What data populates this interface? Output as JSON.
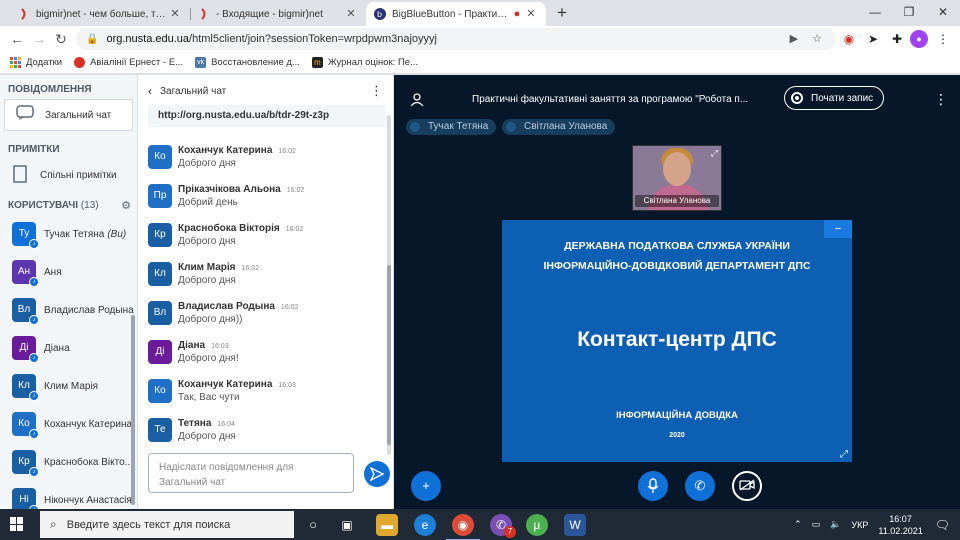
{
  "browser": {
    "tabs": [
      {
        "title": "bigmir)net - чем больше, тем лу"
      },
      {
        "title": "- Входящие - bigmir)net"
      },
      {
        "title": "BigBlueButton - Практичні з"
      }
    ],
    "url_host": "org.nusta.edu.ua",
    "url_path": "/html5client/join?sessionToken=wrpdpwm3najoyyyj",
    "bookmarks": [
      {
        "label": "Додатки",
        "color": "#4285f4"
      },
      {
        "label": "Авіалінії Ернест - Е...",
        "color": "#d93025"
      },
      {
        "label": "Восстановление д...",
        "color": "#4a76a8"
      },
      {
        "label": "Журнал оцінок: Пе...",
        "color": "#f5b400"
      }
    ]
  },
  "nav": {
    "messages_header": "ПОВІДОМЛЕННЯ",
    "public_chat": "Загальний чат",
    "notes_header": "ПРИМІТКИ",
    "shared_notes": "Спільні примітки",
    "users_header": "КОРИСТУВАЧІ",
    "users_count": "(13)",
    "users": [
      {
        "initials": "Ту",
        "name": "Тучак Тетяна",
        "you": "(Ви)",
        "color": "#0f70d7"
      },
      {
        "initials": "Ан",
        "name": "Аня",
        "color": "#5e35b1"
      },
      {
        "initials": "Вл",
        "name": "Владислав Родына",
        "color": "#1a5ea3"
      },
      {
        "initials": "Ді",
        "name": "Діана",
        "color": "#6a1b9a"
      },
      {
        "initials": "Кл",
        "name": "Клим Марія",
        "color": "#1a5ea3"
      },
      {
        "initials": "Ко",
        "name": "Коханчук Катерина",
        "color": "#1e6fc6"
      },
      {
        "initials": "Кр",
        "name": "Краснобока Вікто...",
        "color": "#1a5ea3"
      },
      {
        "initials": "Ні",
        "name": "Нікончук Анастасія",
        "color": "#1a5ea3"
      }
    ]
  },
  "chat": {
    "title": "Загальний чат",
    "pinned_url": "http://org.nusta.edu.ua/b/tdr-29t-z3p",
    "messages": [
      {
        "initials": "Ко",
        "name": "Коханчук Катерина",
        "time": "16:02",
        "text": "Доброго дня",
        "color": "#1e6fc6"
      },
      {
        "initials": "Пр",
        "name": "Пріказчікова Альона",
        "time": "16:02",
        "text": "Добрий день",
        "color": "#1e6fc6"
      },
      {
        "initials": "Кр",
        "name": "Краснобока Вікторія",
        "time": "16:02",
        "text": "Доброго дня",
        "color": "#1a5ea3"
      },
      {
        "initials": "Кл",
        "name": "Клим Марія",
        "time": "16:02",
        "text": "Доброго дня",
        "color": "#1a5ea3"
      },
      {
        "initials": "Вл",
        "name": "Владислав Родына",
        "time": "16:02",
        "text": "Доброго дня))",
        "color": "#1a5ea3"
      },
      {
        "initials": "Ді",
        "name": "Діана",
        "time": "16:03",
        "text": "Доброго дня!",
        "color": "#6a1b9a"
      },
      {
        "initials": "Ко",
        "name": "Коханчук Катерина",
        "time": "16:03",
        "text": "Так, Вас чути",
        "color": "#1e6fc6"
      },
      {
        "initials": "Те",
        "name": "Тетяна",
        "time": "16:04",
        "text": "Доброго дня",
        "color": "#1a5ea3"
      }
    ],
    "input_placeholder": "Надіслати повідомлення для Загальний чат"
  },
  "stage": {
    "title": "Практичні факультативні заняття за програмою \"Робота п...",
    "record_label": "Почати запис",
    "talkers": [
      "Тучак Тетяна",
      "Світлана Уланова"
    ],
    "webcam_name": "Світлана Уланова",
    "slide": {
      "line1": "ДЕРЖАВНА ПОДАТКОВА СЛУЖБА УКРАЇНИ",
      "line2": "ІНФОРМАЦІЙНО-ДОВІДКОВИЙ ДЕПАРТАМЕНТ ДПС",
      "headline": "Контакт-центр ДПС",
      "line4": "ІНФОРМАЦІЙНА ДОВІДКА",
      "year": "2020"
    }
  },
  "taskbar": {
    "search_placeholder": "Введите здесь текст для поиска",
    "language": "УКР",
    "time": "16:07",
    "date": "11.02.2021",
    "notification_count": "7"
  }
}
